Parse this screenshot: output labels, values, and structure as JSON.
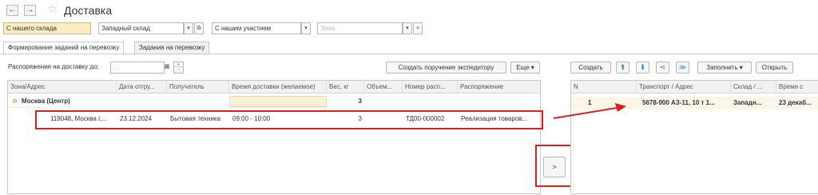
{
  "header": {
    "back_glyph": "←",
    "forward_glyph": "→",
    "star_glyph": "☆",
    "title": "Доставка"
  },
  "filters": {
    "warehouse_mode": "С нашего склада",
    "warehouse": "Западный склад",
    "participation": "С нашим участием",
    "zone_placeholder": "Зона",
    "dropdown_glyph": "▾",
    "open_glyph": "⧉",
    "clear_glyph": "×"
  },
  "tabs": [
    {
      "label": "Формирование заданий на перевозку",
      "active": true
    },
    {
      "label": "Задания на перевозку",
      "active": false
    }
  ],
  "left_toolbar": {
    "date_label": "Распоряжения на доставку до:",
    "date_value": " .  .",
    "calendar_glyph": "▦",
    "create_order_button": "Создать поручение экспедитору",
    "more_button": "Еще",
    "more_glyph": "▾"
  },
  "left_table": {
    "columns": [
      "Зона/Адрес",
      "Дата отгру...",
      "Получатель",
      "Время доставки (желаемое)",
      "Вес, кг",
      "Объем...",
      "Номер расп...",
      "Распоряжение"
    ],
    "group_row": {
      "toggle_glyph": "⊖",
      "zone": "Москва (Центр)",
      "weight": "3"
    },
    "rows": [
      {
        "address": "119048, Москва г,...",
        "date": "23.12.2024",
        "recipient": "Бытовая техника",
        "time": "09:00 - 10:00",
        "weight": "3",
        "volume": "",
        "number": "ТД00-000002",
        "order": "Реализация товаров..."
      }
    ]
  },
  "transfer_button": {
    "label": ">"
  },
  "right_toolbar": {
    "create_button": "Создать",
    "up_glyph": "⬆",
    "down_glyph": "⬇",
    "split_glyph": "⋖",
    "merge_glyph": "≫",
    "fill_button": "Заполнить",
    "fill_glyph": "▾",
    "open_button": "Открыть"
  },
  "right_table": {
    "columns": [
      "N",
      "Транспорт / Адрес",
      "Склад / ...",
      "Время с"
    ],
    "rows": [
      {
        "n": "1",
        "transport": "5678-900 АЗ-11, 10 т 1...",
        "warehouse": "Западн...",
        "time": "23 декаб..."
      }
    ]
  },
  "colors": {
    "highlight": "#d9201e",
    "selected_field": "#fbedbf",
    "icon_blue": "#2e86c8"
  }
}
